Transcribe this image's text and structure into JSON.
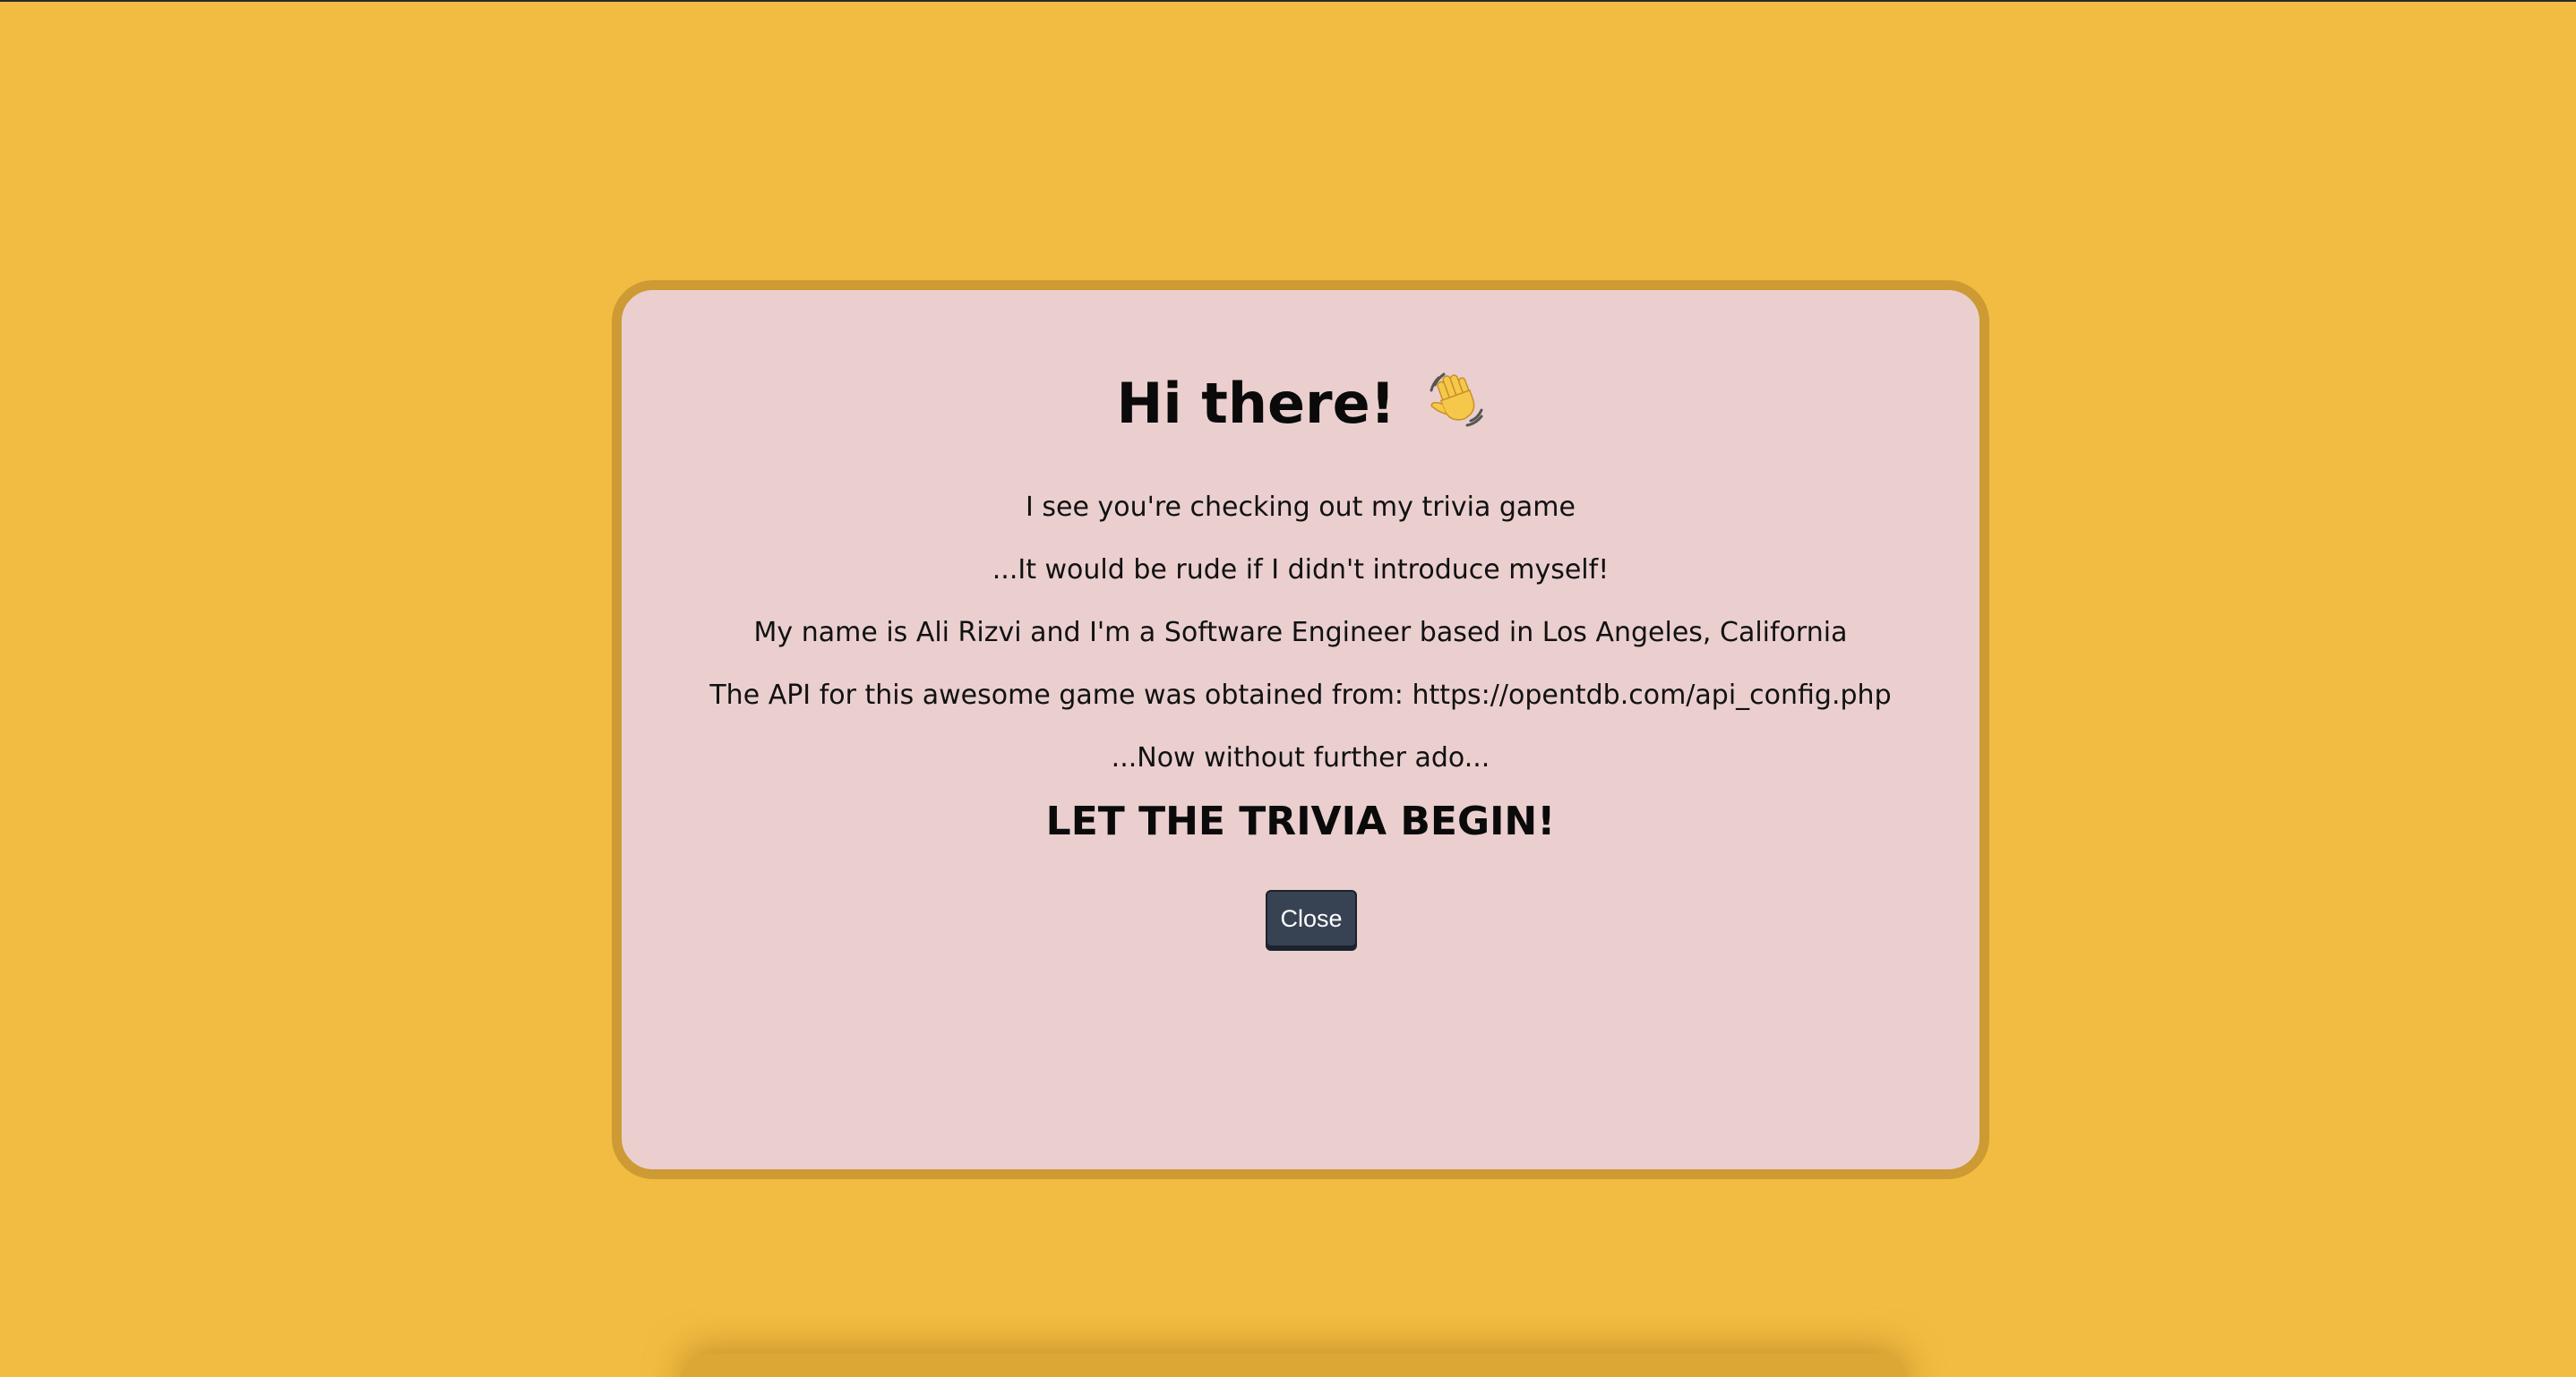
{
  "modal": {
    "title": "Hi there!",
    "title_icon": "waving-hand-icon",
    "lines": [
      "I see you're checking out my trivia game",
      "...It would be rude if I didn't introduce myself!",
      "My name is Ali Rizvi and I'm a Software Engineer based in Los Angeles, California",
      "The API for this awesome game was obtained from: https://opentdb.com/api_config.php",
      "...Now without further ado..."
    ],
    "begin_text": "LET THE TRIVIA BEGIN!",
    "close_label": "Close"
  },
  "colors": {
    "background": "#f2bc42",
    "modal_fill": "#eacfce",
    "modal_border": "#cd9a33",
    "button": "#374253"
  }
}
